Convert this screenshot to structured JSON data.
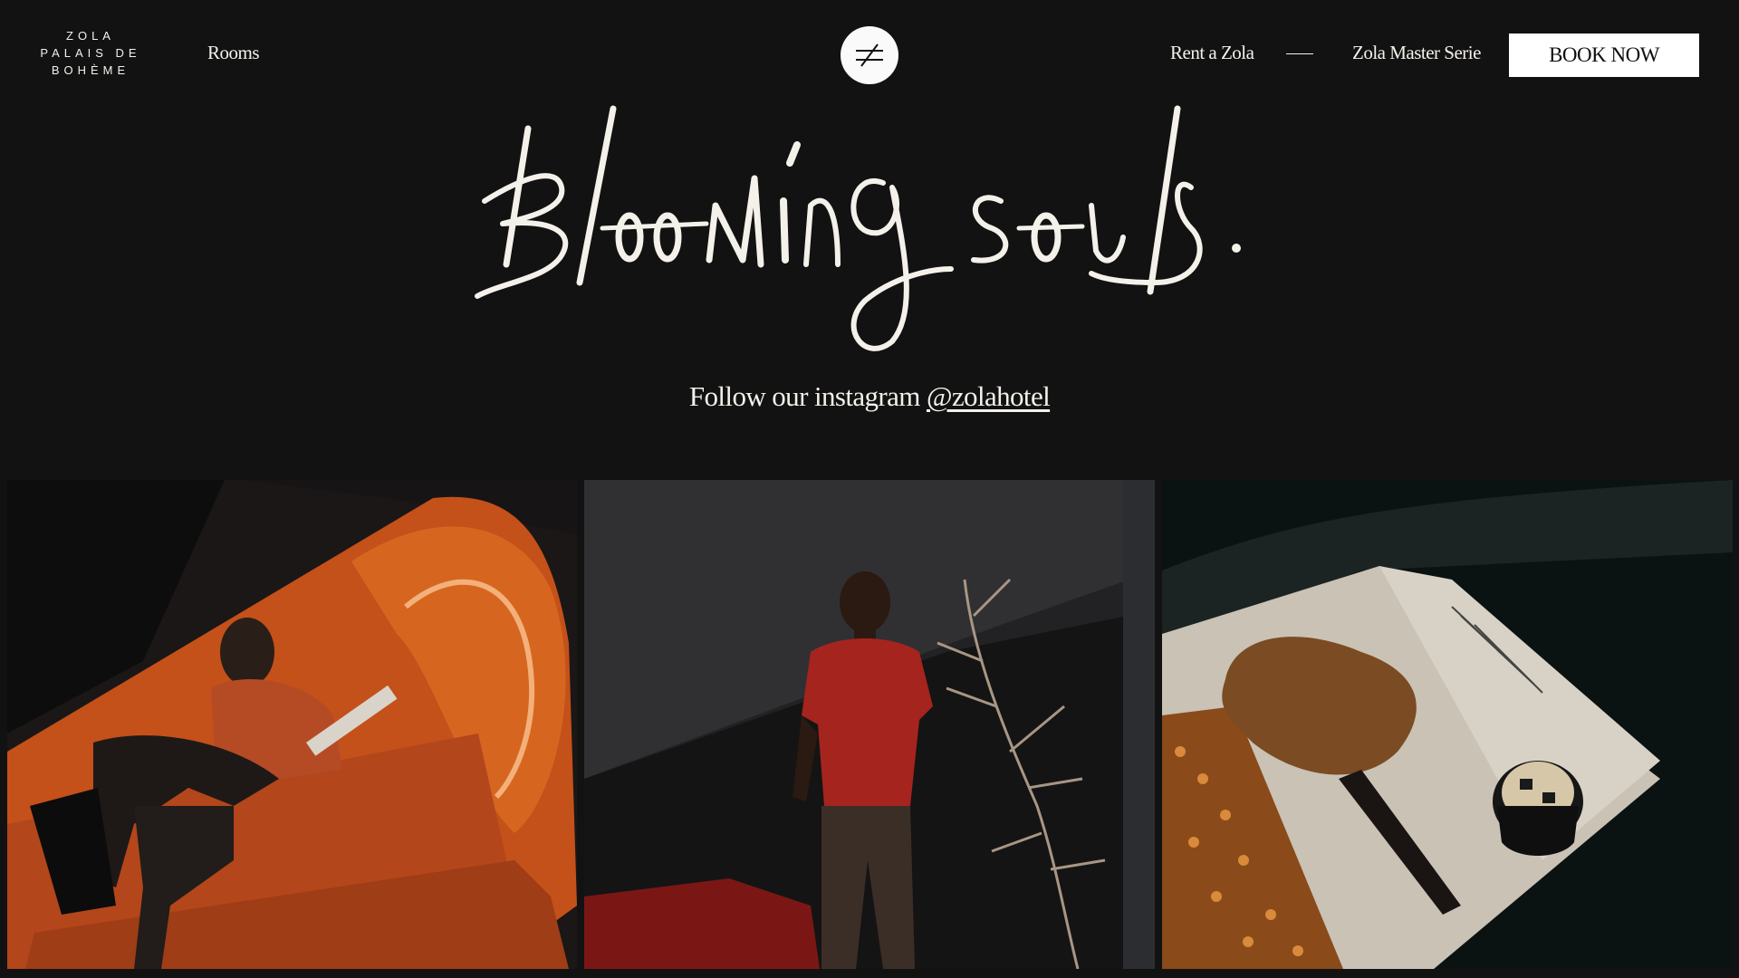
{
  "brand": {
    "logo_lines": [
      "ZOLA",
      "PALAIS DE",
      "BOHÈME"
    ]
  },
  "nav": {
    "left_link": "Rooms",
    "right_links": [
      "Rent a Zola",
      "Zola Master Serie"
    ],
    "book_button": "BOOK NOW"
  },
  "hero": {
    "script_text": "Blooming souls.",
    "follow_text": "Follow our instagram ",
    "instagram_handle": "@zolahotel"
  },
  "icons": {
    "center": "not-equal-icon"
  },
  "colors": {
    "background": "#121212",
    "text": "#f4f1ea",
    "button_bg": "#ffffff",
    "button_text": "#0f0f0f"
  }
}
